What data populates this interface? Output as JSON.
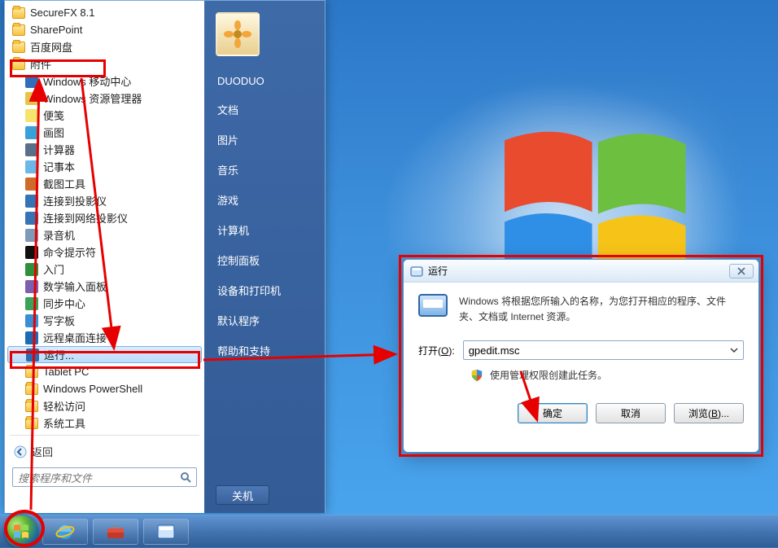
{
  "start_menu": {
    "left_items": [
      {
        "label": "SecureFX 8.1",
        "icon": "folder"
      },
      {
        "label": "SharePoint",
        "icon": "folder"
      },
      {
        "label": "百度网盘",
        "icon": "folder"
      },
      {
        "label": "附件",
        "icon": "folder",
        "boxed": true
      },
      {
        "label": "Windows 移动中心",
        "icon": "exe",
        "color": "#2f6fb9",
        "indent": true
      },
      {
        "label": "Windows 资源管理器",
        "icon": "exe",
        "color": "#e7c34a",
        "indent": true
      },
      {
        "label": "便笺",
        "icon": "exe",
        "color": "#f6e56c",
        "indent": true
      },
      {
        "label": "画图",
        "icon": "exe",
        "color": "#3aa0d8",
        "indent": true
      },
      {
        "label": "计算器",
        "icon": "exe",
        "color": "#5a6f88",
        "indent": true
      },
      {
        "label": "记事本",
        "icon": "exe",
        "color": "#6db7e8",
        "indent": true
      },
      {
        "label": "截图工具",
        "icon": "exe",
        "color": "#d06a2a",
        "indent": true
      },
      {
        "label": "连接到投影仪",
        "icon": "exe",
        "color": "#3574b5",
        "indent": true
      },
      {
        "label": "连接到网络投影仪",
        "icon": "exe",
        "color": "#3574b5",
        "indent": true
      },
      {
        "label": "录音机",
        "icon": "exe",
        "color": "#7d9ab8",
        "indent": true
      },
      {
        "label": "命令提示符",
        "icon": "exe",
        "color": "#111",
        "indent": true
      },
      {
        "label": "入门",
        "icon": "exe",
        "color": "#2f8f3a",
        "indent": true
      },
      {
        "label": "数学输入面板",
        "icon": "exe",
        "color": "#7c5fae",
        "indent": true
      },
      {
        "label": "同步中心",
        "icon": "exe",
        "color": "#3aa25a",
        "indent": true
      },
      {
        "label": "写字板",
        "icon": "exe",
        "color": "#3a8fd4",
        "indent": true
      },
      {
        "label": "远程桌面连接",
        "icon": "exe",
        "color": "#1f6bb3",
        "indent": true
      },
      {
        "label": "运行...",
        "icon": "exe",
        "color": "#2e6bb0",
        "indent": true,
        "selected": true
      },
      {
        "label": "Tablet PC",
        "icon": "folder",
        "indent": true
      },
      {
        "label": "Windows PowerShell",
        "icon": "folder",
        "indent": true
      },
      {
        "label": "轻松访问",
        "icon": "folder",
        "indent": true
      },
      {
        "label": "系统工具",
        "icon": "folder",
        "indent": true
      }
    ],
    "back_label": "返回",
    "search_placeholder": "搜索程序和文件"
  },
  "right_items": [
    "DUODUO",
    "文档",
    "图片",
    "音乐",
    "游戏",
    "计算机",
    "控制面板",
    "设备和打印机",
    "默认程序",
    "帮助和支持"
  ],
  "shutdown_label": "关机",
  "run_dialog": {
    "title": "运行",
    "desc": "Windows 将根据您所输入的名称，为您打开相应的程序、文件夹、文档或 Internet 资源。",
    "open_label": "打开(",
    "open_label_u": "O",
    "open_label_tail": "):",
    "value": "gpedit.msc",
    "admin_text": "使用管理权限创建此任务。",
    "ok": "确定",
    "cancel": "取消",
    "browse_pre": "浏览(",
    "browse_u": "B",
    "browse_post": ")..."
  },
  "taskbar": {
    "start": "Start",
    "ie": "Internet Explorer",
    "tool": "Toolbox",
    "explorer": "Explorer"
  }
}
